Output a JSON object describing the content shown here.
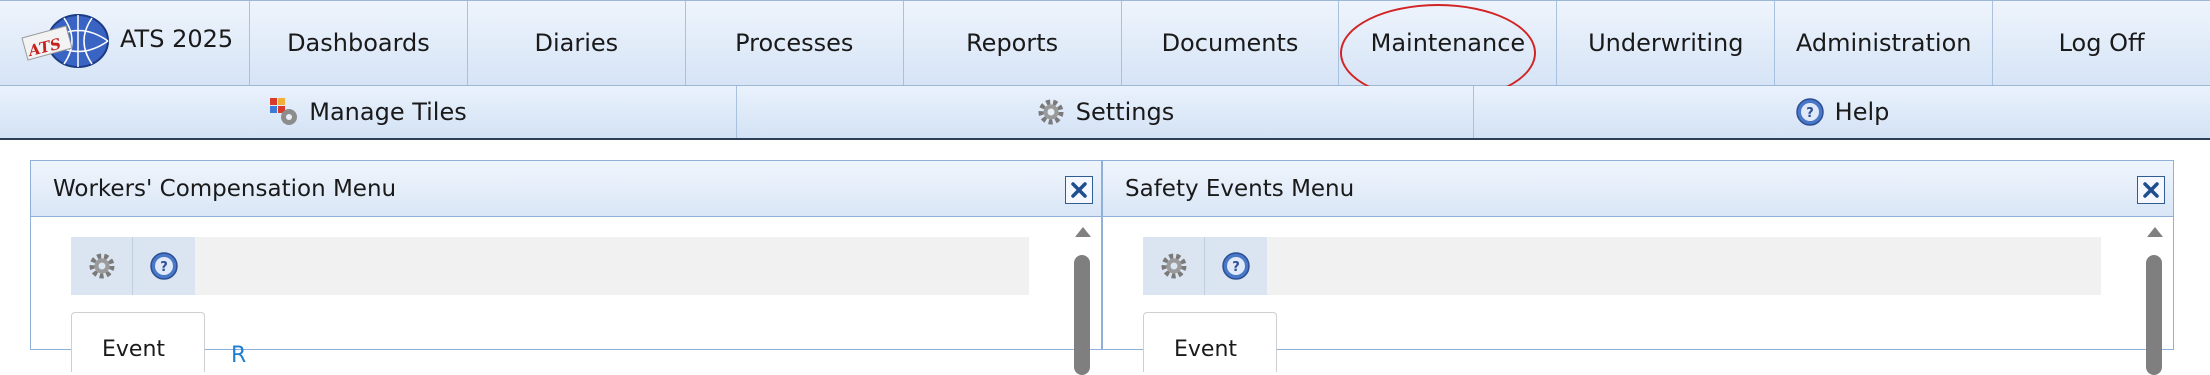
{
  "brand": {
    "label": "ATS 2025",
    "logo_text": "ATS"
  },
  "topnav": {
    "items": [
      {
        "label": "Dashboards"
      },
      {
        "label": "Diaries"
      },
      {
        "label": "Processes"
      },
      {
        "label": "Reports"
      },
      {
        "label": "Documents"
      },
      {
        "label": "Maintenance",
        "highlighted": true
      },
      {
        "label": "Underwriting"
      },
      {
        "label": "Administration"
      },
      {
        "label": "Log Off"
      }
    ]
  },
  "subnav": {
    "items": [
      {
        "label": "Manage Tiles",
        "icon": "manage-tiles-icon"
      },
      {
        "label": "Settings",
        "icon": "gear-icon"
      },
      {
        "label": "Help",
        "icon": "help-icon"
      }
    ]
  },
  "panels": [
    {
      "title": "Workers' Compensation Menu",
      "tab_label": "Event",
      "link_text": "R"
    },
    {
      "title": "Safety Events Menu",
      "tab_label": "Event"
    }
  ],
  "colors": {
    "highlight_ring": "#d12424",
    "link": "#1f7fd0",
    "border": "#8fb0d8"
  }
}
